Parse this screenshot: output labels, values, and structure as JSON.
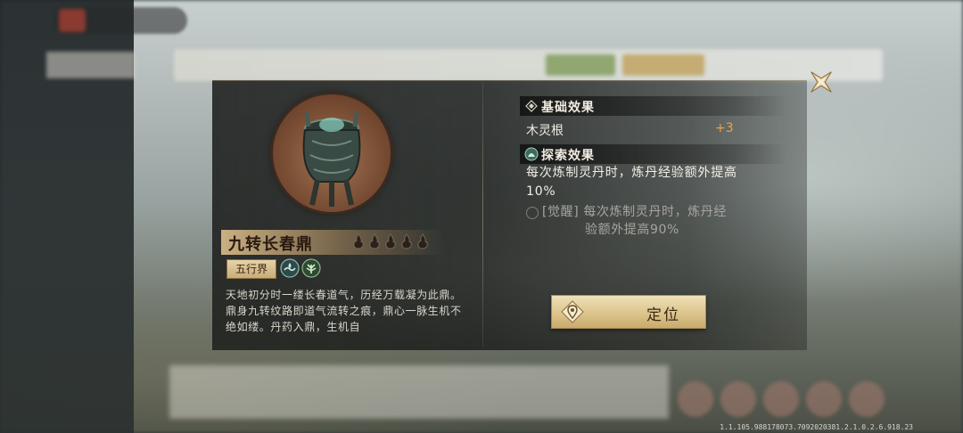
{
  "item": {
    "name": "九转长春鼎",
    "rank_flames": 5,
    "realm_tag": "五行界",
    "description": "天地初分时一缕长春道气，历经万载凝为此鼎。鼎身九转纹路即道气流转之痕，鼎心一脉生机不绝如缕。丹药入鼎，生机自"
  },
  "effects": {
    "base_title": "基础效果",
    "base_stat_label": "木灵根",
    "base_stat_value": "+3",
    "explore_title": "探索效果",
    "explore_text": "每次炼制灵丹时，炼丹经验额外提高10%",
    "awaken_line1": "[觉醒] 每次炼制灵丹时，炼丹经",
    "awaken_line2": "验额外提高90%"
  },
  "actions": {
    "locate_label": "定位"
  },
  "version": "1.1.105.988178073.7092020381.2.1.0.2.6.918.23"
}
